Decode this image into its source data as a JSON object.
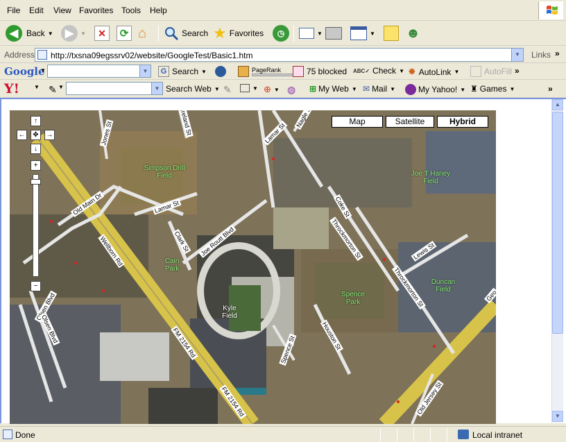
{
  "menu": [
    "File",
    "Edit",
    "View",
    "Favorites",
    "Tools",
    "Help"
  ],
  "toolbar": {
    "back": "Back",
    "search": "Search",
    "favorites": "Favorites"
  },
  "address": {
    "label": "Address",
    "url": "http://txsna09egssrv02/website/GoogleTest/Basic1.htm",
    "links": "Links"
  },
  "google": {
    "logo": "Google",
    "search": "Search",
    "pagerank": "PageRank",
    "blocked": "75 blocked",
    "check": "Check",
    "autolink": "AutoLink",
    "autofill": "AutoFill"
  },
  "yahoo": {
    "logo": "Y!",
    "search_web": "Search Web",
    "my_web": "My Web",
    "mail": "Mail",
    "my_yahoo": "My Yahoo!",
    "games": "Games"
  },
  "map": {
    "types": [
      "Map",
      "Satellite",
      "Hybrid"
    ],
    "active_type": "Hybrid",
    "places": [
      "Simpson Drill Field",
      "Joe T Haney Field",
      "Cain Park",
      "Kyle Field",
      "Spence Park",
      "Duncan Field"
    ],
    "streets": [
      "Old Main Dr",
      "Lamar St",
      "Joe Routt Blvd",
      "Clark St",
      "Wellborn Rd",
      "FM 2154 Rd",
      "Coke St",
      "Throckmorton St",
      "Lewis St",
      "Houston St",
      "Olsen Blvd",
      "Jones St",
      "Nagle St",
      "Ireland St",
      "Bizzell St",
      "Old Jersey St",
      "Spence St",
      "Geo"
    ]
  },
  "status": {
    "text": "Done",
    "zone": "Local intranet"
  }
}
